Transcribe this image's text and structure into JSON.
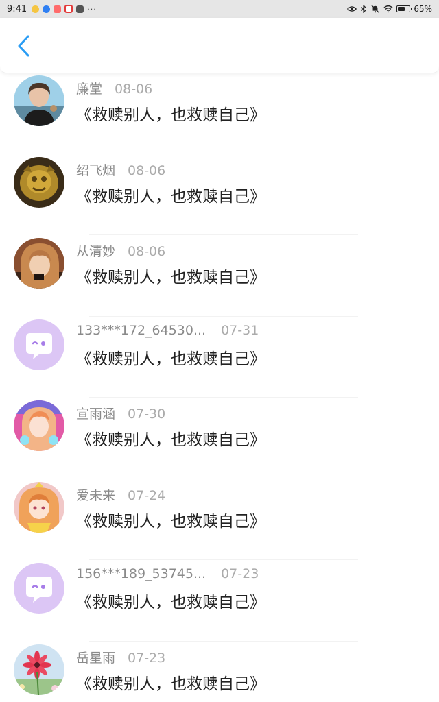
{
  "status_bar": {
    "time": "9:41",
    "more": "···",
    "battery_text": "65%",
    "battery_level": 0.65,
    "app_icon_colors": [
      "#f5c542",
      "#2f7ff2",
      "#ff6b6b",
      "#e23b3b",
      "#555555"
    ]
  },
  "header": {
    "back_icon": "chevron-left-icon",
    "accent_color": "#2a9df4"
  },
  "comments": [
    {
      "nickname": "廉堂",
      "date": "08-06",
      "text": "《救赎别人，也救赎自己》",
      "avatar": "photo"
    },
    {
      "nickname": "绍飞烟",
      "date": "08-06",
      "text": "《救赎别人，也救赎自己》",
      "avatar": "photo"
    },
    {
      "nickname": "从清妙",
      "date": "08-06",
      "text": "《救赎别人，也救赎自己》",
      "avatar": "photo"
    },
    {
      "nickname": "133***172_64530...",
      "date": "07-31",
      "text": "《救赎别人，也救赎自己》",
      "avatar": "default-chat-bubble"
    },
    {
      "nickname": "宣雨涵",
      "date": "07-30",
      "text": "《救赎别人，也救赎自己》",
      "avatar": "photo"
    },
    {
      "nickname": "爱未来",
      "date": "07-24",
      "text": "《救赎别人，也救赎自己》",
      "avatar": "photo"
    },
    {
      "nickname": "156***189_53745...",
      "date": "07-23",
      "text": "《救赎别人，也救赎自己》",
      "avatar": "default-chat-bubble"
    },
    {
      "nickname": "岳星雨",
      "date": "07-23",
      "text": "《救赎别人，也救赎自己》",
      "avatar": "photo"
    }
  ],
  "colors": {
    "nickname": "#8a8a8a",
    "date": "#ababab",
    "content": "#222222",
    "default_avatar_bg": "#dcc6f5",
    "default_avatar_fg": "#a77de8"
  }
}
